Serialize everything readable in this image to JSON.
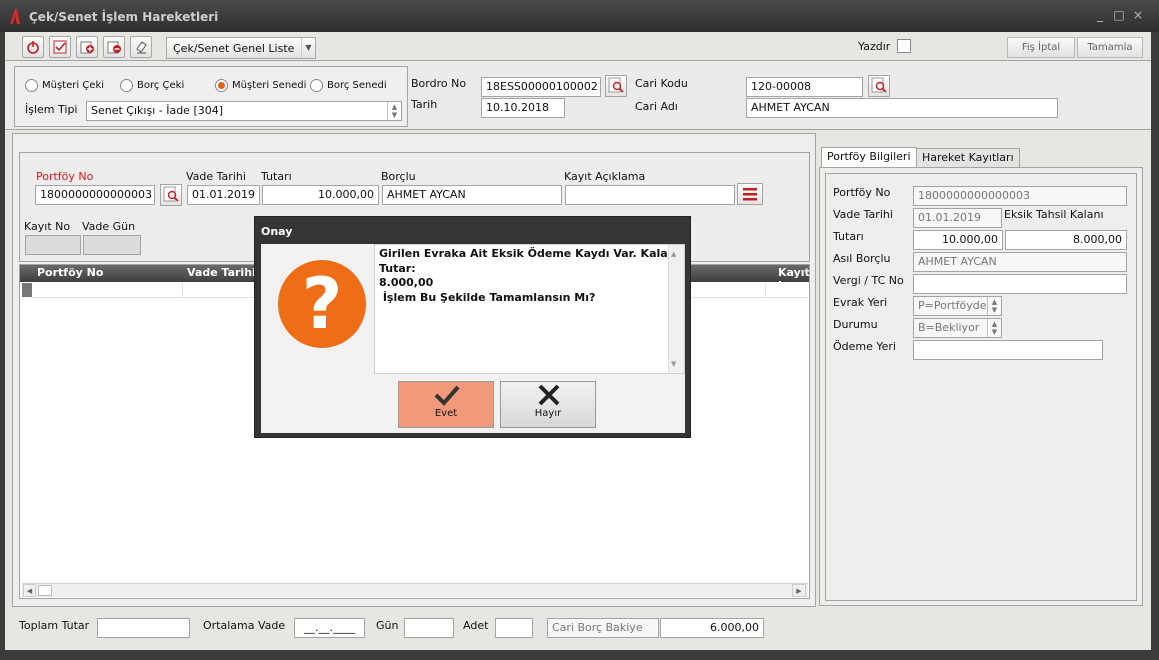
{
  "window": {
    "title": "Çek/Senet İşlem Hareketleri",
    "controls": [
      "_",
      "□",
      "×"
    ]
  },
  "toolbar": {
    "tool_icons": [
      "power-icon",
      "checklist-icon",
      "add-record-icon",
      "remove-record-icon",
      "eraser-icon"
    ],
    "list_button_label": "Çek/Senet Genel Liste",
    "print_label": "Yazdır",
    "cancel_receipt_label": "Fiş İptal",
    "complete_label": "Tamamla"
  },
  "header": {
    "radios": [
      {
        "label": "Müşteri Çeki",
        "selected": false
      },
      {
        "label": "Borç Çeki",
        "selected": false
      },
      {
        "label": "Müşteri Senedi",
        "selected": true
      },
      {
        "label": "Borç Senedi",
        "selected": false
      }
    ],
    "transaction_type_label": "İşlem Tipi",
    "transaction_type_value": "Senet Çıkışı - İade [304]",
    "bordro_label": "Bordro No",
    "bordro_value": "18ESS00000100002",
    "date_label": "Tarih",
    "date_value": "10.10.2018",
    "account_code_label": "Cari Kodu",
    "account_code_value": "120-00008",
    "account_name_label": "Cari Adı",
    "account_name_value": "AHMET AYCAN"
  },
  "entry": {
    "portfolio_label": "Portföy No",
    "portfolio_value": "1800000000000003",
    "due_label": "Vade Tarihi",
    "due_value": "01.01.2019",
    "amount_label": "Tutarı",
    "amount_value": "10.000,00",
    "debtor_label": "Borçlu",
    "debtor_value": "AHMET AYCAN",
    "note_label": "Kayıt Açıklama",
    "note_value": "",
    "record_no_label": "Kayıt No",
    "due_days_label": "Vade Gün"
  },
  "grid": {
    "col_portfolio": "Portföy No",
    "col_due": "Vade Tarihi",
    "col_record": "Kayıt I"
  },
  "tabs": {
    "portfolio_info": "Portföy Bilgileri",
    "movement_records": "Hareket Kayıtları"
  },
  "info": {
    "portfolio_label": "Portföy No",
    "portfolio_value": "1800000000000003",
    "due_label": "Vade Tarihi",
    "due_value": "01.01.2019",
    "missing_label": "Eksik Tahsil Kalanı",
    "amount_label": "Tutarı",
    "amount_value": "10.000,00",
    "missing_value": "8.000,00",
    "main_debtor_label": "Asıl Borçlu",
    "main_debtor_value": "AHMET AYCAN",
    "tax_label": "Vergi / TC No",
    "tax_value": "",
    "location_label": "Evrak Yeri",
    "location_value": "P=Portföyde",
    "status_label": "Durumu",
    "status_value": "B=Bekliyor",
    "payment_place_label": "Ödeme Yeri",
    "payment_place_value": ""
  },
  "footer": {
    "total_label": "Toplam Tutar",
    "total_value": "",
    "avg_due_label": "Ortalama Vade",
    "avg_due_value": "__.__.____",
    "days_label": "Gün",
    "days_value": "",
    "count_label": "Adet",
    "count_value": "",
    "balance_label": "Cari Borç Bakiye",
    "balance_value": "6.000,00"
  },
  "dialog": {
    "title": "Onay",
    "message_line1": "Girilen Evraka Ait Eksik Ödeme Kaydı Var. Kalan Tutar:",
    "message_line2": "8.000,00",
    "message_line3": " İşlem Bu Şekilde Tamamlansın Mı?",
    "question_mark": "?",
    "yes_label": "Evet",
    "no_label": "Hayır"
  },
  "colors": {
    "accent": "#ee6e17",
    "required_label": "#d42020",
    "yes_button": "#f3997a"
  }
}
